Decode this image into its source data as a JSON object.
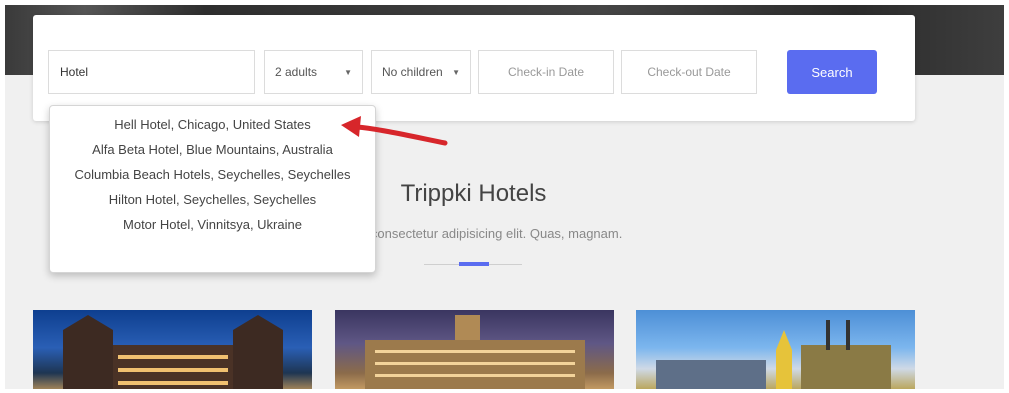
{
  "search": {
    "destination_value": "Hotel",
    "adults_value": "2 adults",
    "children_value": "No children",
    "checkin_placeholder": "Check-in Date",
    "checkout_placeholder": "Check-out Date",
    "button_label": "Search",
    "button_color": "#5a6cf0"
  },
  "suggestions": [
    "Hell Hotel, Chicago, United States",
    "Alfa Beta Hotel, Blue Mountains, Australia",
    "Columbia Beach Hotels, Seychelles, Seychelles",
    "Hilton Hotel, Seychelles, Seychelles",
    "Motor Hotel, Vinnitsya, Ukraine"
  ],
  "annotation": {
    "arrow_color": "#d7262b",
    "icon": "red-arrow-icon"
  },
  "section": {
    "title": "Trippki Hotels",
    "subtitle": "it amet, consectetur adipisicing elit. Quas, magnam.",
    "accent_color": "#5a6cf0"
  },
  "icons": {
    "select_caret": "caret-down-icon"
  }
}
